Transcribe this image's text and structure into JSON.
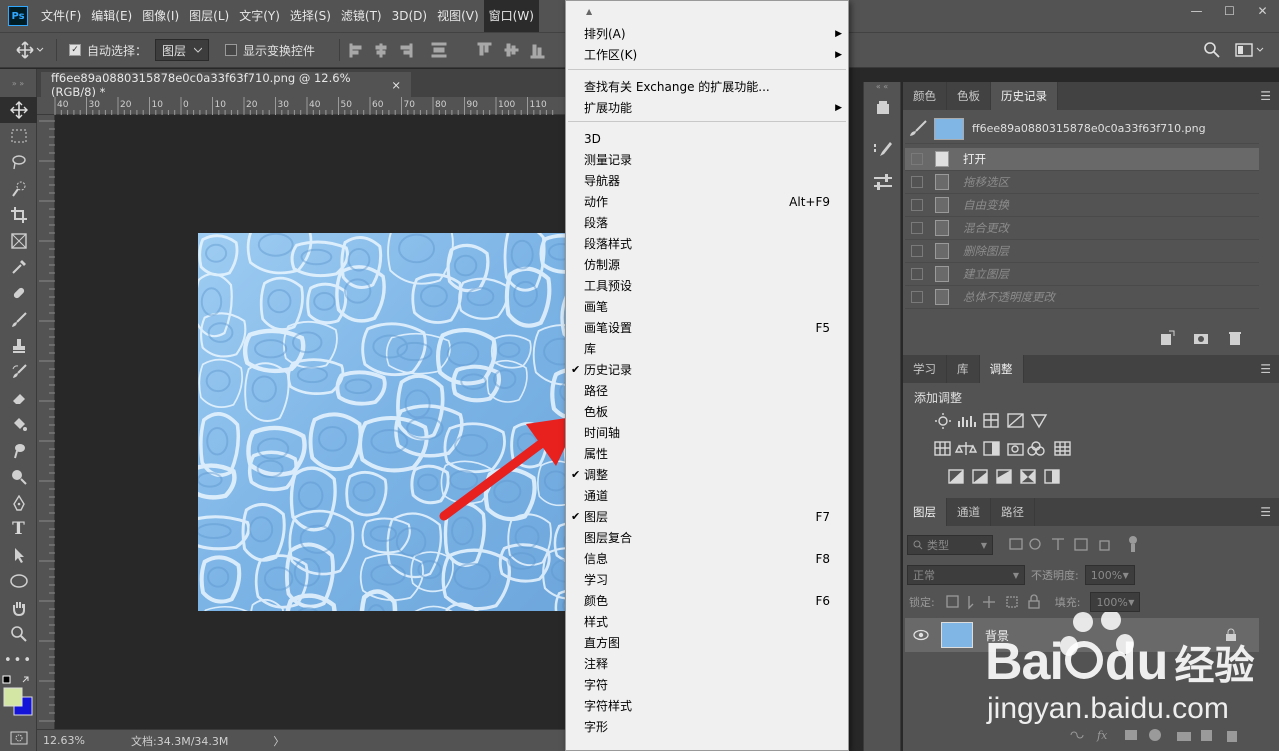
{
  "app": {
    "logo": "Ps",
    "menu": [
      "文件(F)",
      "编辑(E)",
      "图像(I)",
      "图层(L)",
      "文字(Y)",
      "选择(S)",
      "滤镜(T)",
      "3D(D)",
      "视图(V)",
      "窗口(W)"
    ],
    "window_controls": [
      "—",
      "☐",
      "✕"
    ]
  },
  "options": {
    "auto_select_label": "自动选择：",
    "auto_select_value": "图层",
    "show_transform_label": "显示变换控件"
  },
  "document": {
    "tab_title": "ff6ee89a0880315878e0c0a33f63f710.png @ 12.6%(RGB/8) *",
    "tab_close": "×",
    "ruler_ticks": [
      "40",
      "30",
      "20",
      "10",
      "0",
      "10",
      "20",
      "30",
      "40",
      "50",
      "60",
      "70",
      "80",
      "90",
      "100",
      "110"
    ],
    "zoom": "12.63%",
    "doc_info": "文档:34.3M/34.3M",
    "status_arrow": "〉"
  },
  "dropdown": {
    "items": [
      {
        "label": "排列(A)",
        "submenu": true
      },
      {
        "label": "工作区(K)",
        "submenu": true
      },
      {
        "label": "查找有关 Exchange 的扩展功能...",
        "submenu": false
      },
      {
        "label": "扩展功能",
        "submenu": true
      },
      {
        "label": "3D"
      },
      {
        "label": "测量记录"
      },
      {
        "label": "导航器"
      },
      {
        "label": "动作",
        "shortcut": "Alt+F9"
      },
      {
        "label": "段落"
      },
      {
        "label": "段落样式"
      },
      {
        "label": "仿制源"
      },
      {
        "label": "工具预设"
      },
      {
        "label": "画笔"
      },
      {
        "label": "画笔设置",
        "shortcut": "F5"
      },
      {
        "label": "库"
      },
      {
        "label": "历史记录",
        "checked": true
      },
      {
        "label": "路径"
      },
      {
        "label": "色板"
      },
      {
        "label": "时间轴"
      },
      {
        "label": "属性"
      },
      {
        "label": "调整",
        "checked": true
      },
      {
        "label": "通道"
      },
      {
        "label": "图层",
        "checked": true,
        "shortcut": "F7"
      },
      {
        "label": "图层复合"
      },
      {
        "label": "信息",
        "shortcut": "F8"
      },
      {
        "label": "学习"
      },
      {
        "label": "颜色",
        "shortcut": "F6"
      },
      {
        "label": "样式"
      },
      {
        "label": "直方图"
      },
      {
        "label": "注释"
      },
      {
        "label": "字符"
      },
      {
        "label": "字符样式"
      },
      {
        "label": "字形"
      }
    ],
    "check_glyph": "✔",
    "submenu_glyph": "▶",
    "scroll_up_glyph": "▲"
  },
  "history_panel": {
    "tabs": [
      "颜色",
      "色板",
      "历史记录"
    ],
    "active_tab": "历史记录",
    "snapshot_name": "ff6ee89a0880315878e0c0a33f63f710.png",
    "steps": [
      "打开",
      "拖移选区",
      "自由变换",
      "混合更改",
      "删除图层",
      "建立图层",
      "总体不透明度更改"
    ],
    "active_step": "打开"
  },
  "adjust_panel": {
    "tabs": [
      "学习",
      "库",
      "调整"
    ],
    "active_tab": "调整",
    "heading": "添加调整"
  },
  "layers_panel": {
    "tabs": [
      "图层",
      "通道",
      "路径"
    ],
    "active_tab": "图层",
    "filter_label": "类型",
    "blend_mode": "正常",
    "opacity_label": "不透明度:",
    "opacity_value": "100%",
    "lock_label": "锁定:",
    "fill_label": "填充:",
    "fill_value": "100%",
    "layer_name": "背景"
  },
  "watermark": {
    "brand_left": "Bai",
    "brand_right": "du",
    "brand_cn": "经验",
    "url": "jingyan.baidu.com"
  },
  "colors": {
    "menubar": "#535353",
    "menu_bg": "#f0f0f0",
    "arrow": "#e8201e",
    "foreground_swatch": "#d4e6a4",
    "background_swatch": "#1414d8",
    "water": "#7fb6e6"
  }
}
